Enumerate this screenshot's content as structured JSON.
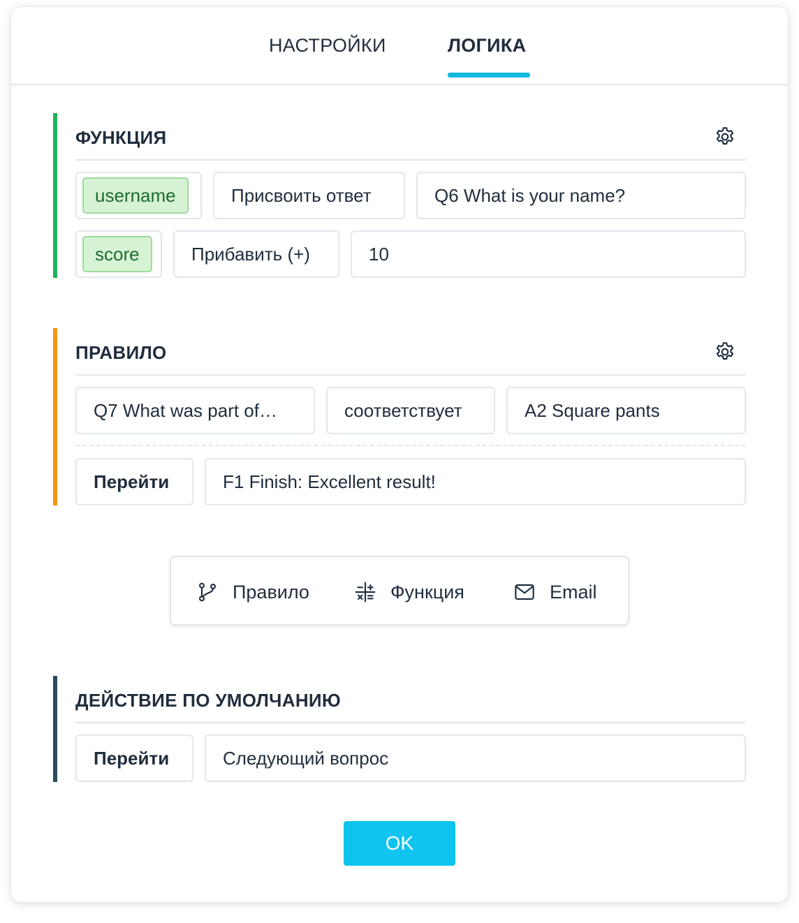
{
  "tabs": [
    {
      "label": "НАСТРОЙКИ",
      "active": false
    },
    {
      "label": "ЛОГИКА",
      "active": true
    }
  ],
  "accent_color": "#0fb9e0",
  "function_section": {
    "title": "ФУНКЦИЯ",
    "color": "#1db45a",
    "rows": [
      {
        "variable": "username",
        "operation": "Присвоить ответ",
        "value": "Q6 What is your name?"
      },
      {
        "variable": "score",
        "operation": "Прибавить (+)",
        "value": "10"
      }
    ]
  },
  "rule_section": {
    "title": "ПРАВИЛО",
    "color": "#f5960f",
    "condition": {
      "question": "Q7 What was part of…",
      "operator": "соответствует",
      "answer": "A2 Square pants"
    },
    "action": {
      "label": "Перейти",
      "target": "F1 Finish: Excellent result!"
    }
  },
  "add_menu": {
    "rule_label": "Правило",
    "function_label": "Функция",
    "email_label": "Email"
  },
  "default_section": {
    "title": "ДЕЙСТВИЕ ПО УМОЛЧАНИЮ",
    "color": "#2e4a5e",
    "action": {
      "label": "Перейти",
      "target": "Следующий вопрос"
    }
  },
  "ok_button": {
    "label": "OK"
  }
}
